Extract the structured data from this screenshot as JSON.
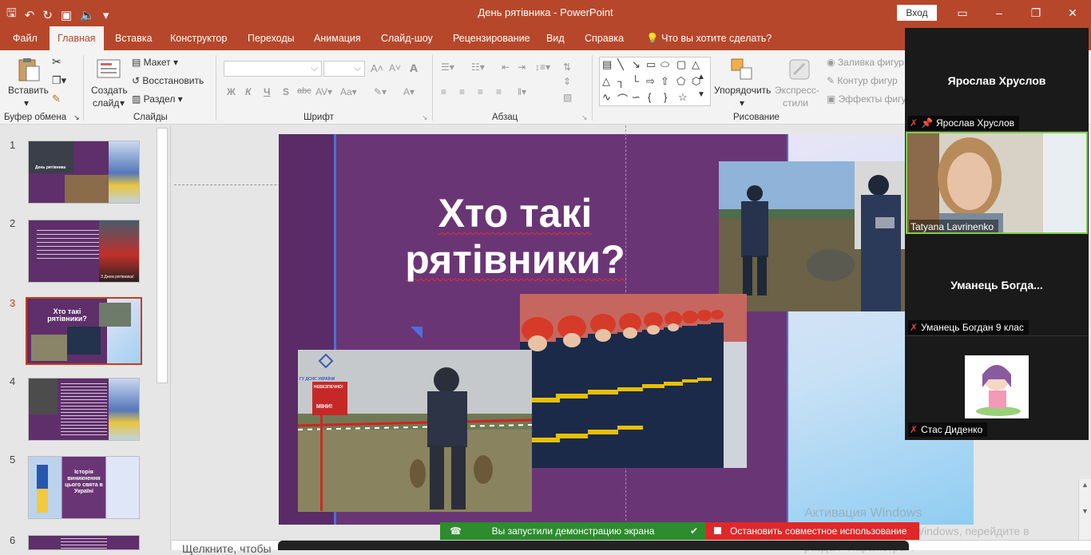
{
  "window": {
    "title": "День рятівника  -  PowerPoint",
    "login": "Вход"
  },
  "tabs": [
    "Файл",
    "Главная",
    "Вставка",
    "Конструктор",
    "Переходы",
    "Анимация",
    "Слайд-шоу",
    "Рецензирование",
    "Вид",
    "Справка",
    "Что вы хотите сделать?"
  ],
  "ribbon": {
    "paste": "Вставить",
    "clipboard": "Буфер обмена",
    "create_slide_1": "Создать",
    "create_slide_2": "слайд",
    "layout": "Макет",
    "reset": "Восстановить",
    "section": "Раздел",
    "slides": "Слайды",
    "font": "Шрифт",
    "bold": "Ж",
    "italic": "К",
    "underline": "Ч",
    "strike": "S",
    "abc": "abc",
    "paragraph": "Абзац",
    "arrange_1": "Упорядочить",
    "express_1": "Экспресс-",
    "express_2": "стили",
    "fill": "Заливка фигур",
    "outline": "Контур фигур",
    "effects": "Эффекты фигур",
    "drawing": "Рисование"
  },
  "thumbnails": [
    {
      "num": "1",
      "caption": "День рятівника"
    },
    {
      "num": "2",
      "caption": "З Днем рятівника!"
    },
    {
      "num": "3",
      "caption": "Хто такі рятівники?"
    },
    {
      "num": "4",
      "caption": ""
    },
    {
      "num": "5",
      "caption": "Історія виникнення цього свята в Україні"
    },
    {
      "num": "6",
      "caption": ""
    }
  ],
  "slide": {
    "title_line1": "Хто такі",
    "title_line2": "рятівники?",
    "sign_top": "ГУ ДСНС УКРАЇНИ",
    "sign_danger": "НЕБЕЗПЕЧНО!",
    "sign_mines": "МІНИ!"
  },
  "notes_placeholder": "Щелкните, чтобы",
  "zoom": {
    "participants": [
      {
        "big_name": "Ярослав Хруслов",
        "tag": "Ярослав Хруслов",
        "muted": true,
        "pinned": true
      },
      {
        "big_name": "",
        "tag": "Tatyana Lavrinenko",
        "muted": false,
        "pinned": false
      },
      {
        "big_name": "Уманець  Богда...",
        "tag": "Уманець Богдан 9 клас",
        "muted": true,
        "pinned": false
      },
      {
        "big_name": "",
        "tag": "Стас Диденко",
        "muted": true,
        "pinned": false
      }
    ],
    "share_status": "Вы запустили демонстрацию экрана",
    "stop_share": "Остановить совместное использование"
  },
  "activation": {
    "line1": "Активация Windows",
    "line2": "Чтобы активировать Windows, перейдите в",
    "line3": "раздел \"Параметры\"."
  },
  "colors": {
    "accent": "#b7472a",
    "slide_bg": "#6a3575",
    "share_green": "#2d8c2d",
    "share_red": "#e02828"
  }
}
